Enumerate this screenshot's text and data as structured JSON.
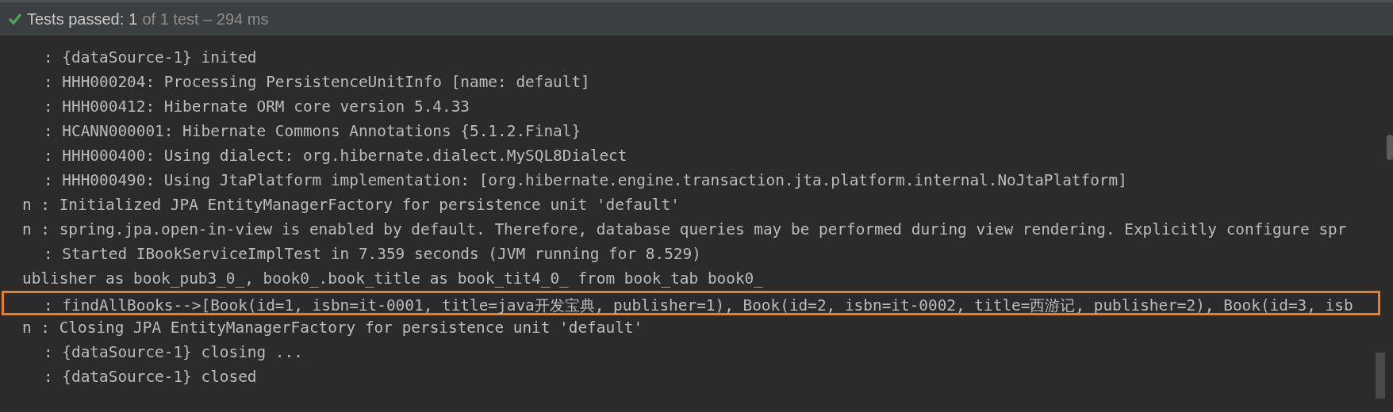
{
  "status_bar": {
    "label": "Tests passed:",
    "count": "1",
    "detail": "of 1 test – 294 ms",
    "passed": true
  },
  "console": {
    "lines": [
      {
        "kind": "indented",
        "text": ": {dataSource-1} inited",
        "highlighted": false
      },
      {
        "kind": "indented",
        "text": ": HHH000204: Processing PersistenceUnitInfo [name: default]",
        "highlighted": false
      },
      {
        "kind": "indented",
        "text": ": HHH000412: Hibernate ORM core version 5.4.33",
        "highlighted": false
      },
      {
        "kind": "indented",
        "text": ": HCANN000001: Hibernate Commons Annotations {5.1.2.Final}",
        "highlighted": false
      },
      {
        "kind": "indented",
        "text": ": HHH000400: Using dialect: org.hibernate.dialect.MySQL8Dialect",
        "highlighted": false
      },
      {
        "kind": "indented",
        "text": ": HHH000490: Using JtaPlatform implementation: [org.hibernate.engine.transaction.jta.platform.internal.NoJtaPlatform]",
        "highlighted": false
      },
      {
        "kind": "flush",
        "text": "n : Initialized JPA EntityManagerFactory for persistence unit 'default'",
        "highlighted": false
      },
      {
        "kind": "flush",
        "text": "n : spring.jpa.open-in-view is enabled by default. Therefore, database queries may be performed during view rendering. Explicitly configure spr",
        "highlighted": false
      },
      {
        "kind": "indented",
        "text": ": Started IBookServiceImplTest in 7.359 seconds (JVM running for 8.529)",
        "highlighted": false
      },
      {
        "kind": "flush",
        "text": "ublisher as book_pub3_0_, book0_.book_title as book_tit4_0_ from book_tab book0_",
        "highlighted": false
      },
      {
        "kind": "indented",
        "text": ": findAllBooks-->[Book(id=1, isbn=it-0001, title=java开发宝典, publisher=1), Book(id=2, isbn=it-0002, title=西游记, publisher=2), Book(id=3, isb",
        "highlighted": true
      },
      {
        "kind": "flush",
        "text": "n : Closing JPA EntityManagerFactory for persistence unit 'default'",
        "highlighted": false
      },
      {
        "kind": "indented",
        "text": ": {dataSource-1} closing ...",
        "highlighted": false
      },
      {
        "kind": "indented",
        "text": ": {dataSource-1} closed",
        "highlighted": false
      }
    ]
  }
}
